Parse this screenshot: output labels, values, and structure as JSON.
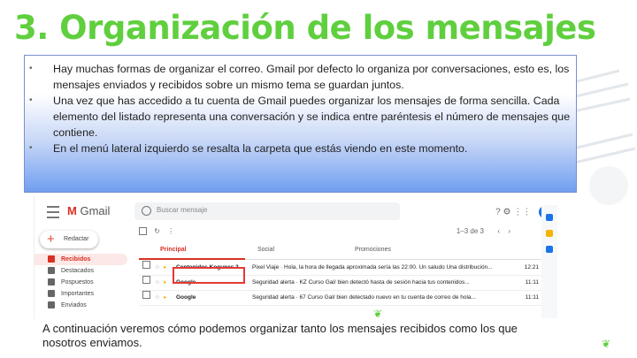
{
  "slide": {
    "title": "3. Organización de los mensajes",
    "bullets": [
      "Hay muchas formas de organizar el correo. Gmail por defecto lo organiza por conversaciones, esto es, los mensajes enviados y recibidos sobre un mismo tema se guardan juntos.",
      "Una vez que has accedido a tu cuenta de Gmail puedes organizar los mensajes de forma sencilla. Cada elemento del listado representa una conversación y se indica entre paréntesis el número de mensajes que contiene.",
      "En el menú lateral izquierdo se resalta la carpeta que estás viendo en este momento."
    ],
    "caption": "A continuación veremos cómo podemos organizar tanto los mensajes recibidos como los que nosotros enviamos.",
    "colors": {
      "title": "#5fcf3e",
      "box_bottom": "#6f9ff0",
      "highlight": "#e53935"
    }
  },
  "gmail": {
    "logo": "Gmail",
    "search_placeholder": "Buscar mensaje",
    "page_info": "1–3 de 3",
    "compose_label": "Redactar",
    "sidebar": [
      "Recibidos",
      "Destacados",
      "Pospuestos",
      "Importantes",
      "Enviados"
    ],
    "tabs": [
      "Principal",
      "Social",
      "Promociones"
    ],
    "rows": [
      {
        "sender": "Contenidos Kogunes 3",
        "subject": "Pixel Viaje · Hola, la hora de llegada aproximada sería las 22:00. Un saludo Una distribución...",
        "time": "12:21"
      },
      {
        "sender": "Google",
        "subject": "Seguridad alerta · KZ Curso Gal/ bien detectó hasta de sesión hacia tus contenidos...",
        "time": "11:11"
      },
      {
        "sender": "Google",
        "subject": "Seguridad alerta · 67 Curso Gal/ bien detectado nuevo en tu cuenta de correo de hola...",
        "time": "11:11"
      }
    ]
  }
}
